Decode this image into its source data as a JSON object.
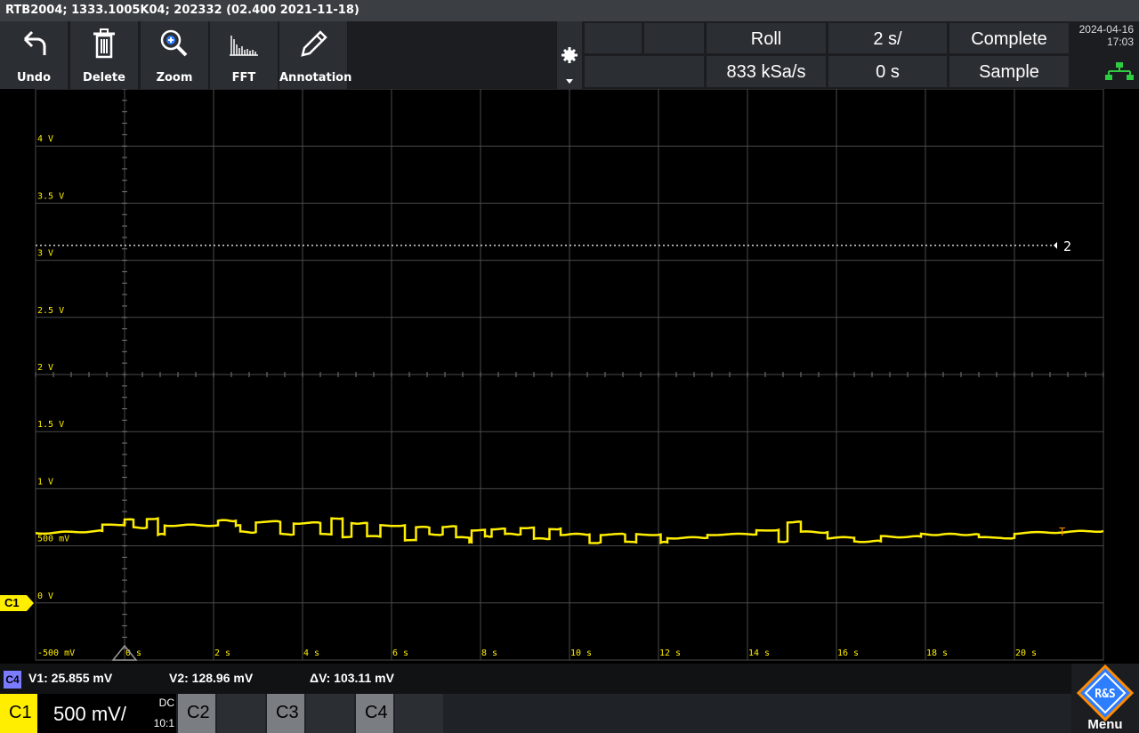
{
  "title": "RTB2004; 1333.1005K04; 202332 (02.400 2021-11-18)",
  "toolbar": {
    "undo": "Undo",
    "delete": "Delete",
    "zoom": "Zoom",
    "fft": "FFT",
    "annotation": "Annotation"
  },
  "status": {
    "mode": "Roll",
    "timebase": "2 s/",
    "acq_state": "Complete",
    "sample_rate": "833 kSa/s",
    "offset": "0 s",
    "acq_mode": "Sample",
    "date": "2024-04-16",
    "time": "17:03"
  },
  "colors": {
    "ch1": "#ffee00",
    "ch4": "#7b7bff",
    "grid": "#4a4a4a",
    "trigger": "#ff8c00"
  },
  "chart_data": {
    "type": "line",
    "ylim": [
      -0.5,
      4.5
    ],
    "xlim": [
      -2,
      22
    ],
    "y_ticks": [
      {
        "v": 4,
        "label": "4 V"
      },
      {
        "v": 3.5,
        "label": "3.5 V"
      },
      {
        "v": 3,
        "label": "3 V"
      },
      {
        "v": 2.5,
        "label": "2.5 V"
      },
      {
        "v": 2,
        "label": "2 V"
      },
      {
        "v": 1.5,
        "label": "1.5 V"
      },
      {
        "v": 1,
        "label": "1 V"
      },
      {
        "v": 0.5,
        "label": "500 mV"
      },
      {
        "v": 0,
        "label": "0 V"
      },
      {
        "v": -0.5,
        "label": "-500 mV"
      }
    ],
    "x_ticks": [
      {
        "v": 0,
        "label": "0 s"
      },
      {
        "v": 2,
        "label": "2 s"
      },
      {
        "v": 4,
        "label": "4 s"
      },
      {
        "v": 6,
        "label": "6 s"
      },
      {
        "v": 8,
        "label": "8 s"
      },
      {
        "v": 10,
        "label": "10 s"
      },
      {
        "v": 12,
        "label": "12 s"
      },
      {
        "v": 14,
        "label": "14 s"
      },
      {
        "v": 16,
        "label": "16 s"
      },
      {
        "v": 18,
        "label": "18 s"
      },
      {
        "v": 20,
        "label": "20 s"
      }
    ],
    "cursor_level_v": 3.13,
    "cursor_label": "2",
    "series": [
      {
        "values": [
          [
            -2,
            0.61
          ],
          [
            -0.5,
            0.63
          ],
          [
            -0.5,
            0.68
          ],
          [
            0,
            0.68
          ],
          [
            0,
            0.73
          ],
          [
            0.2,
            0.73
          ],
          [
            0.2,
            0.66
          ],
          [
            0.5,
            0.66
          ],
          [
            0.5,
            0.74
          ],
          [
            0.75,
            0.74
          ],
          [
            0.75,
            0.6
          ],
          [
            0.9,
            0.6
          ],
          [
            0.9,
            0.68
          ],
          [
            2.1,
            0.68
          ],
          [
            2.1,
            0.72
          ],
          [
            2.5,
            0.72
          ],
          [
            2.5,
            0.68
          ],
          [
            2.6,
            0.68
          ],
          [
            2.6,
            0.62
          ],
          [
            2.95,
            0.62
          ],
          [
            2.95,
            0.71
          ],
          [
            3.5,
            0.71
          ],
          [
            3.5,
            0.6
          ],
          [
            3.8,
            0.6
          ],
          [
            3.8,
            0.7
          ],
          [
            4.4,
            0.7
          ],
          [
            4.4,
            0.6
          ],
          [
            4.65,
            0.6
          ],
          [
            4.65,
            0.74
          ],
          [
            4.9,
            0.74
          ],
          [
            4.9,
            0.58
          ],
          [
            5.1,
            0.58
          ],
          [
            5.1,
            0.7
          ],
          [
            5.45,
            0.7
          ],
          [
            5.45,
            0.58
          ],
          [
            5.75,
            0.58
          ],
          [
            5.75,
            0.68
          ],
          [
            6.3,
            0.68
          ],
          [
            6.3,
            0.55
          ],
          [
            6.55,
            0.55
          ],
          [
            6.55,
            0.66
          ],
          [
            6.85,
            0.66
          ],
          [
            6.85,
            0.6
          ],
          [
            7.15,
            0.6
          ],
          [
            7.15,
            0.67
          ],
          [
            7.45,
            0.67
          ],
          [
            7.45,
            0.57
          ],
          [
            7.75,
            0.57
          ],
          [
            7.75,
            0.53
          ],
          [
            7.8,
            0.53
          ],
          [
            7.8,
            0.64
          ],
          [
            8.1,
            0.64
          ],
          [
            8.1,
            0.58
          ],
          [
            8.25,
            0.58
          ],
          [
            8.25,
            0.65
          ],
          [
            8.55,
            0.65
          ],
          [
            8.55,
            0.6
          ],
          [
            8.9,
            0.6
          ],
          [
            8.9,
            0.66
          ],
          [
            9.2,
            0.66
          ],
          [
            9.2,
            0.56
          ],
          [
            9.55,
            0.56
          ],
          [
            9.55,
            0.65
          ],
          [
            9.8,
            0.65
          ],
          [
            9.8,
            0.6
          ],
          [
            10.45,
            0.6
          ],
          [
            10.45,
            0.53
          ],
          [
            10.7,
            0.53
          ],
          [
            10.7,
            0.6
          ],
          [
            11.25,
            0.6
          ],
          [
            11.25,
            0.53
          ],
          [
            11.5,
            0.53
          ],
          [
            11.5,
            0.6
          ],
          [
            12.05,
            0.6
          ],
          [
            12.05,
            0.53
          ],
          [
            12.2,
            0.53
          ],
          [
            12.2,
            0.57
          ],
          [
            13.1,
            0.57
          ],
          [
            13.1,
            0.6
          ],
          [
            14.2,
            0.6
          ],
          [
            14.2,
            0.64
          ],
          [
            14.7,
            0.64
          ],
          [
            14.7,
            0.54
          ],
          [
            14.9,
            0.54
          ],
          [
            14.9,
            0.71
          ],
          [
            15.2,
            0.71
          ],
          [
            15.2,
            0.62
          ],
          [
            15.8,
            0.62
          ],
          [
            15.8,
            0.57
          ],
          [
            16.4,
            0.57
          ],
          [
            16.4,
            0.54
          ],
          [
            17.0,
            0.54
          ],
          [
            17.0,
            0.58
          ],
          [
            17.9,
            0.58
          ],
          [
            17.9,
            0.6
          ],
          [
            19.2,
            0.6
          ],
          [
            19.2,
            0.57
          ],
          [
            20.0,
            0.57
          ],
          [
            20.0,
            0.61
          ],
          [
            22,
            0.63
          ]
        ]
      }
    ]
  },
  "screen_labels": {
    "ch1_marker": "C1",
    "trigger_marker": "T"
  },
  "measurement": {
    "channel": "C4",
    "v1": "V1: 25.855 mV",
    "v2": "V2: 128.96 mV",
    "dv": "ΔV: 103.11 mV"
  },
  "channels": {
    "c1": {
      "name": "C1",
      "scale": "500 mV/",
      "coupling": "DC",
      "probe": "10:1"
    },
    "c2": {
      "name": "C2"
    },
    "c3": {
      "name": "C3"
    },
    "c4": {
      "name": "C4"
    }
  },
  "menu_label": "Menu",
  "logo_text": "R&S"
}
